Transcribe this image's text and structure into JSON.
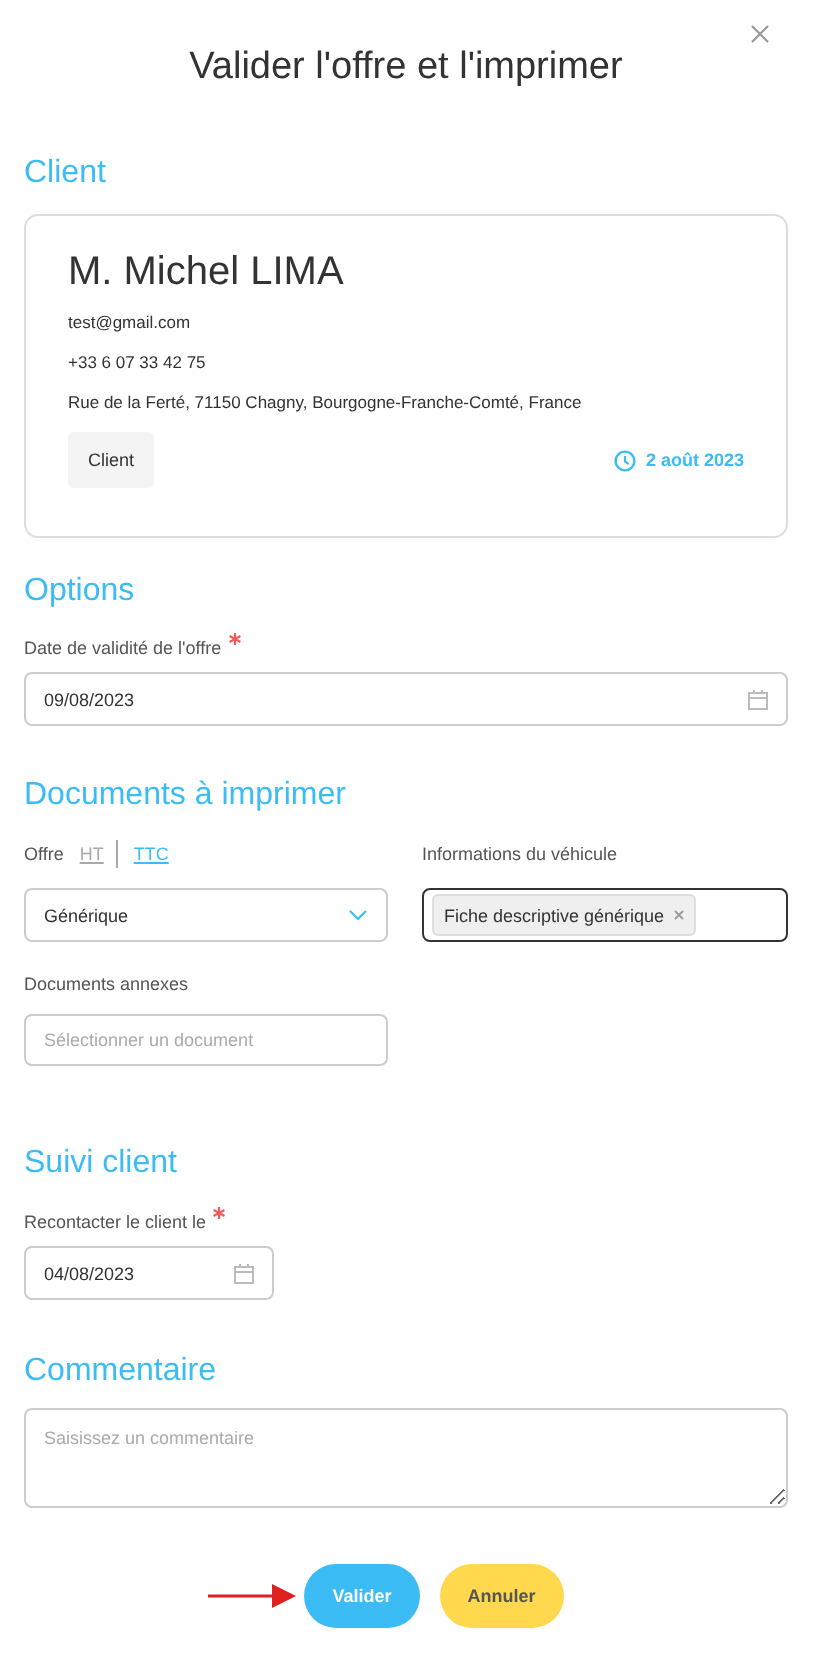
{
  "title": "Valider l'offre et l'imprimer",
  "client": {
    "heading": "Client",
    "name": "M. Michel LIMA",
    "email": "test@gmail.com",
    "phone": "+33 6 07 33 42 75",
    "address": "Rue de la Ferté, 71150 Chagny, Bourgogne-Franche-Comté, France",
    "tag": "Client",
    "date": "2 août 2023"
  },
  "options": {
    "heading": "Options",
    "validity": {
      "label": "Date de validité de l'offre",
      "required": true,
      "value": "09/08/2023"
    }
  },
  "documents": {
    "heading": "Documents à imprimer",
    "offer_label": "Offre",
    "price_modes": [
      {
        "label": "HT",
        "selected": false
      },
      {
        "label": "TTC",
        "selected": true
      }
    ],
    "offer_select": {
      "value": "Générique"
    },
    "vehicle": {
      "label": "Informations du véhicule",
      "focused": true,
      "tags": [
        "Fiche descriptive générique"
      ]
    },
    "annexes": {
      "label": "Documents annexes",
      "placeholder": "Sélectionner un document"
    }
  },
  "follow_up": {
    "heading": "Suivi client",
    "contact": {
      "label": "Recontacter le client le",
      "required": true,
      "value": "04/08/2023"
    }
  },
  "comment": {
    "heading": "Commentaire",
    "placeholder": "Saisissez un commentaire"
  },
  "buttons": [
    {
      "label": "Valider",
      "kind": "primary"
    },
    {
      "label": "Annuler",
      "kind": "secondary"
    }
  ]
}
